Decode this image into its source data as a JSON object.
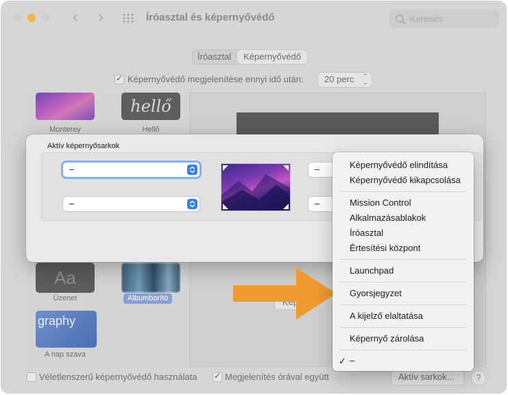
{
  "window": {
    "title": "Íróasztal és képernyővédő",
    "back_glyph": "‹",
    "forward_glyph": "›",
    "search_placeholder": "Keresés"
  },
  "tabs": [
    {
      "label": "Íróasztal",
      "selected": false
    },
    {
      "label": "Képernyővédő",
      "selected": true
    }
  ],
  "show_after": {
    "label": "Képernyővédő megjelenítése ennyi idő után:",
    "checked": true,
    "value": "20 perc",
    "chevron": "⌃⌄"
  },
  "savers": {
    "items": [
      {
        "name": "Monterey"
      },
      {
        "name": "Hellő",
        "art_text": "hellő"
      },
      {
        "name": "Üzenet",
        "art_text": "Aa"
      },
      {
        "name": "Albumborító",
        "selected": true
      },
      {
        "name": "A nap szava",
        "art_text": "graphy"
      }
    ]
  },
  "hot_corners": {
    "title": "Aktív képernyősarkok",
    "top_left": "–",
    "bottom_left": "–",
    "top_right": "–",
    "bottom_right": "–"
  },
  "menu": {
    "items": [
      "Képernyővédő elindítása",
      "Képernyővédő kikapcsolása",
      "Mission Control",
      "Alkalmazásablakok",
      "Íróasztal",
      "Értesítési központ",
      "Launchpad",
      "Gyorsjegyzet",
      "A kijelző elaltatása",
      "Képernyő zárolása",
      "–"
    ],
    "checked_item": "–",
    "check_glyph": "✓"
  },
  "preview_button_label": "Képe",
  "bottom": {
    "random_label": "Véletlenszerű képernyővédő használata",
    "random_checked": false,
    "clock_label": "Megjelenítés órával együtt",
    "clock_checked": true,
    "hot_corners_button": "Aktív sarkok...",
    "help": "?"
  },
  "colors": {
    "accent": "#2f7ef5",
    "arrow": "#f09a30",
    "menu_bg": "#f2f2f2"
  }
}
